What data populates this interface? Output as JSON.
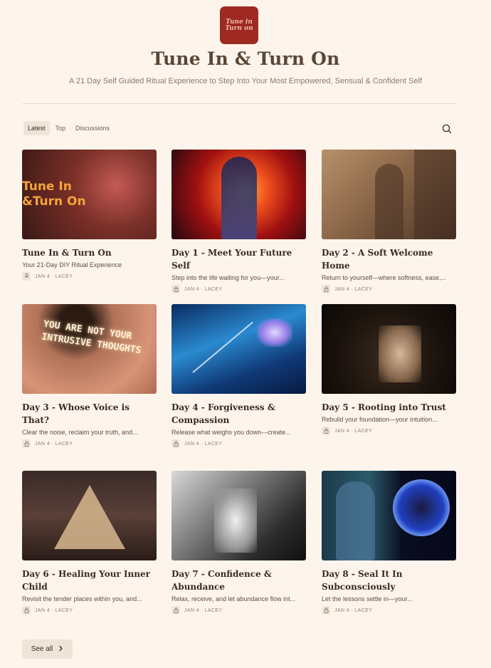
{
  "header": {
    "logo_line1": "Tune in",
    "logo_line2": "Turn on",
    "title": "Tune In & Turn On",
    "subtitle": "A 21 Day Self Guided Ritual Experience to Step Into Your Most Empowered, Sensual & Confident Self"
  },
  "tabs": [
    {
      "label": "Latest",
      "active": true
    },
    {
      "label": "Top",
      "active": false
    },
    {
      "label": "Discussions",
      "active": false
    }
  ],
  "posts": [
    {
      "title": "Tune In & Turn On",
      "desc": "Your 21-Day DIY Ritual Experience",
      "meta": "JAN 4 · LACEY",
      "thumb_text": "Tune In &Turn On",
      "icon": "mic-icon"
    },
    {
      "title": "Day 1 - Meet Your Future Self",
      "desc": "Step into the life waiting for you—your...",
      "meta": "JAN 4 · LACEY",
      "icon": "lock-icon"
    },
    {
      "title": "Day 2 - A Soft Welcome Home",
      "desc": "Return to yourself—where softness, ease,...",
      "meta": "JAN 4 · LACEY",
      "icon": "lock-icon"
    },
    {
      "title": "Day 3 - Whose Voice is That?",
      "desc": "Clear the noise, reclaim your truth, and...",
      "meta": "JAN 4 · LACEY",
      "thumb_text": "YOU ARE NOT YOUR INTRUSIVE THOUGHTS",
      "icon": "lock-icon"
    },
    {
      "title": "Day 4 - Forgiveness & Compassion",
      "desc": "Release what weighs you down—create...",
      "meta": "JAN 4 · LACEY",
      "icon": "lock-icon"
    },
    {
      "title": "Day 5 - Rooting into Trust",
      "desc": "Rebuild your foundation—your intuition...",
      "meta": "JAN 4 · LACEY",
      "icon": "lock-icon"
    },
    {
      "title": "Day 6 - Healing Your Inner Child",
      "desc": "Revisit the tender places within you, and...",
      "meta": "JAN 4 · LACEY",
      "icon": "lock-icon"
    },
    {
      "title": "Day 7 - Confidence & Abundance",
      "desc": "Relax, receive, and let abundance flow int...",
      "meta": "JAN 4 · LACEY",
      "icon": "lock-icon"
    },
    {
      "title": "Day 8 - Seal It In Subconsciously",
      "desc": "Let the lessons settle in—your...",
      "meta": "JAN 4 · LACEY",
      "icon": "lock-icon"
    }
  ],
  "footer": {
    "see_all_label": "See all"
  }
}
